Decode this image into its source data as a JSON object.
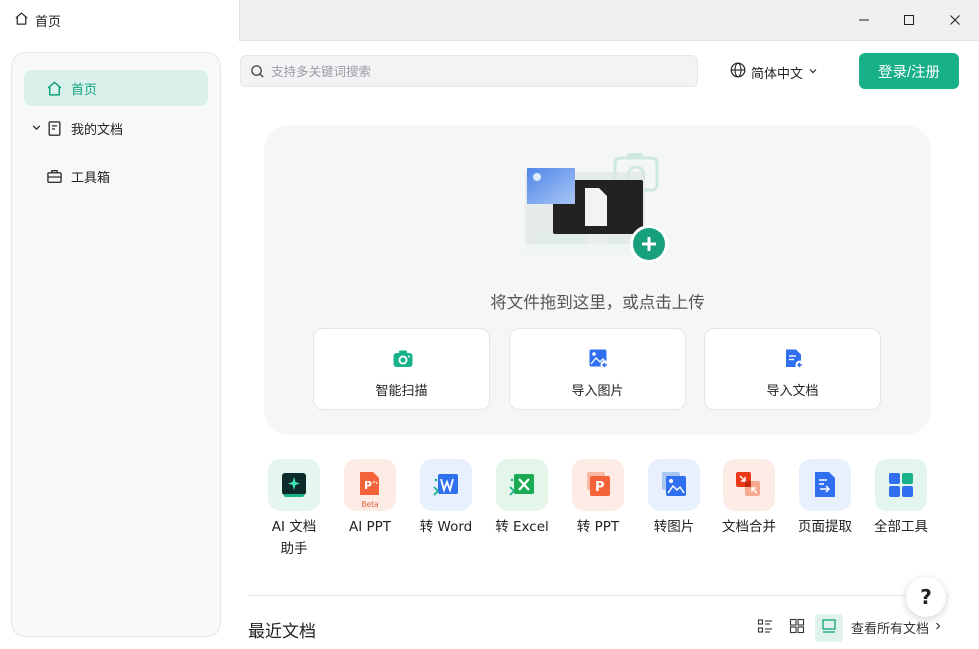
{
  "titlebar": {
    "tab_label": "首页"
  },
  "sidebar": {
    "items": [
      {
        "label": "首页",
        "icon": "home-icon",
        "active": true
      },
      {
        "label": "我的文档",
        "icon": "document-icon",
        "expandable": true
      },
      {
        "label": "工具箱",
        "icon": "toolbox-icon"
      }
    ]
  },
  "search": {
    "placeholder": "支持多关键词搜索",
    "value": ""
  },
  "language": {
    "label": "简体中文"
  },
  "login": {
    "label": "登录/注册"
  },
  "upload": {
    "prompt": "将文件拖到这里，或点击上传",
    "cards": [
      {
        "label": "智能扫描",
        "icon": "camera-scan-icon"
      },
      {
        "label": "导入图片",
        "icon": "import-image-icon"
      },
      {
        "label": "导入文档",
        "icon": "import-document-icon"
      }
    ]
  },
  "tools": [
    {
      "label": "AI 文档助手",
      "line1": "AI 文档",
      "line2": "助手",
      "icon": "ai-document-icon"
    },
    {
      "label": "AI PPT",
      "line1": "AI PPT",
      "line2": "",
      "icon": "ai-ppt-icon",
      "badge": "Beta"
    },
    {
      "label": "转 Word",
      "line1": "转 Word",
      "line2": "",
      "icon": "to-word-icon"
    },
    {
      "label": "转 Excel",
      "line1": "转 Excel",
      "line2": "",
      "icon": "to-excel-icon"
    },
    {
      "label": "转 PPT",
      "line1": "转 PPT",
      "line2": "",
      "icon": "to-ppt-icon"
    },
    {
      "label": "转图片",
      "line1": "转图片",
      "line2": "",
      "icon": "to-image-icon"
    },
    {
      "label": "文档合并",
      "line1": "文档合并",
      "line2": "",
      "icon": "merge-document-icon"
    },
    {
      "label": "页面提取",
      "line1": "页面提取",
      "line2": "",
      "icon": "page-extract-icon"
    },
    {
      "label": "全部工具",
      "line1": "全部工具",
      "line2": "",
      "icon": "all-tools-icon"
    }
  ],
  "recent": {
    "title": "最近文档",
    "view_all": "查看所有文档"
  },
  "help": {
    "label": "?"
  },
  "colors": {
    "accent": "#17b088",
    "active_bg": "#d9f1ea"
  }
}
